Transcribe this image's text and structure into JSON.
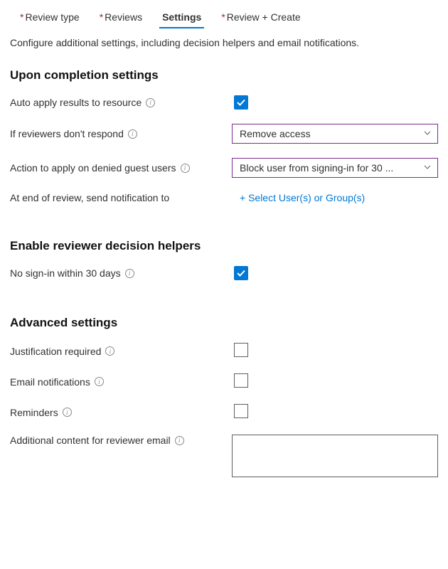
{
  "tabs": {
    "review_type": "Review type",
    "reviews": "Reviews",
    "settings": "Settings",
    "review_create": "Review + Create"
  },
  "intro": "Configure additional settings, including decision helpers and email notifications.",
  "sections": {
    "completion": {
      "title": "Upon completion settings",
      "auto_apply_label": "Auto apply results to resource",
      "auto_apply_checked": true,
      "if_no_respond_label": "If reviewers don't respond",
      "if_no_respond_value": "Remove access",
      "denied_guest_label": "Action to apply on denied guest users",
      "denied_guest_value": "Block user from signing-in for 30 ...",
      "end_notify_label": "At end of review, send notification to",
      "end_notify_action": "+ Select User(s) or Group(s)"
    },
    "helpers": {
      "title": "Enable reviewer decision helpers",
      "no_signin_label": "No sign-in within 30 days",
      "no_signin_checked": true
    },
    "advanced": {
      "title": "Advanced settings",
      "justification_label": "Justification required",
      "justification_checked": false,
      "email_label": "Email notifications",
      "email_checked": false,
      "reminders_label": "Reminders",
      "reminders_checked": false,
      "additional_content_label": "Additional content for reviewer email",
      "additional_content_value": ""
    }
  }
}
